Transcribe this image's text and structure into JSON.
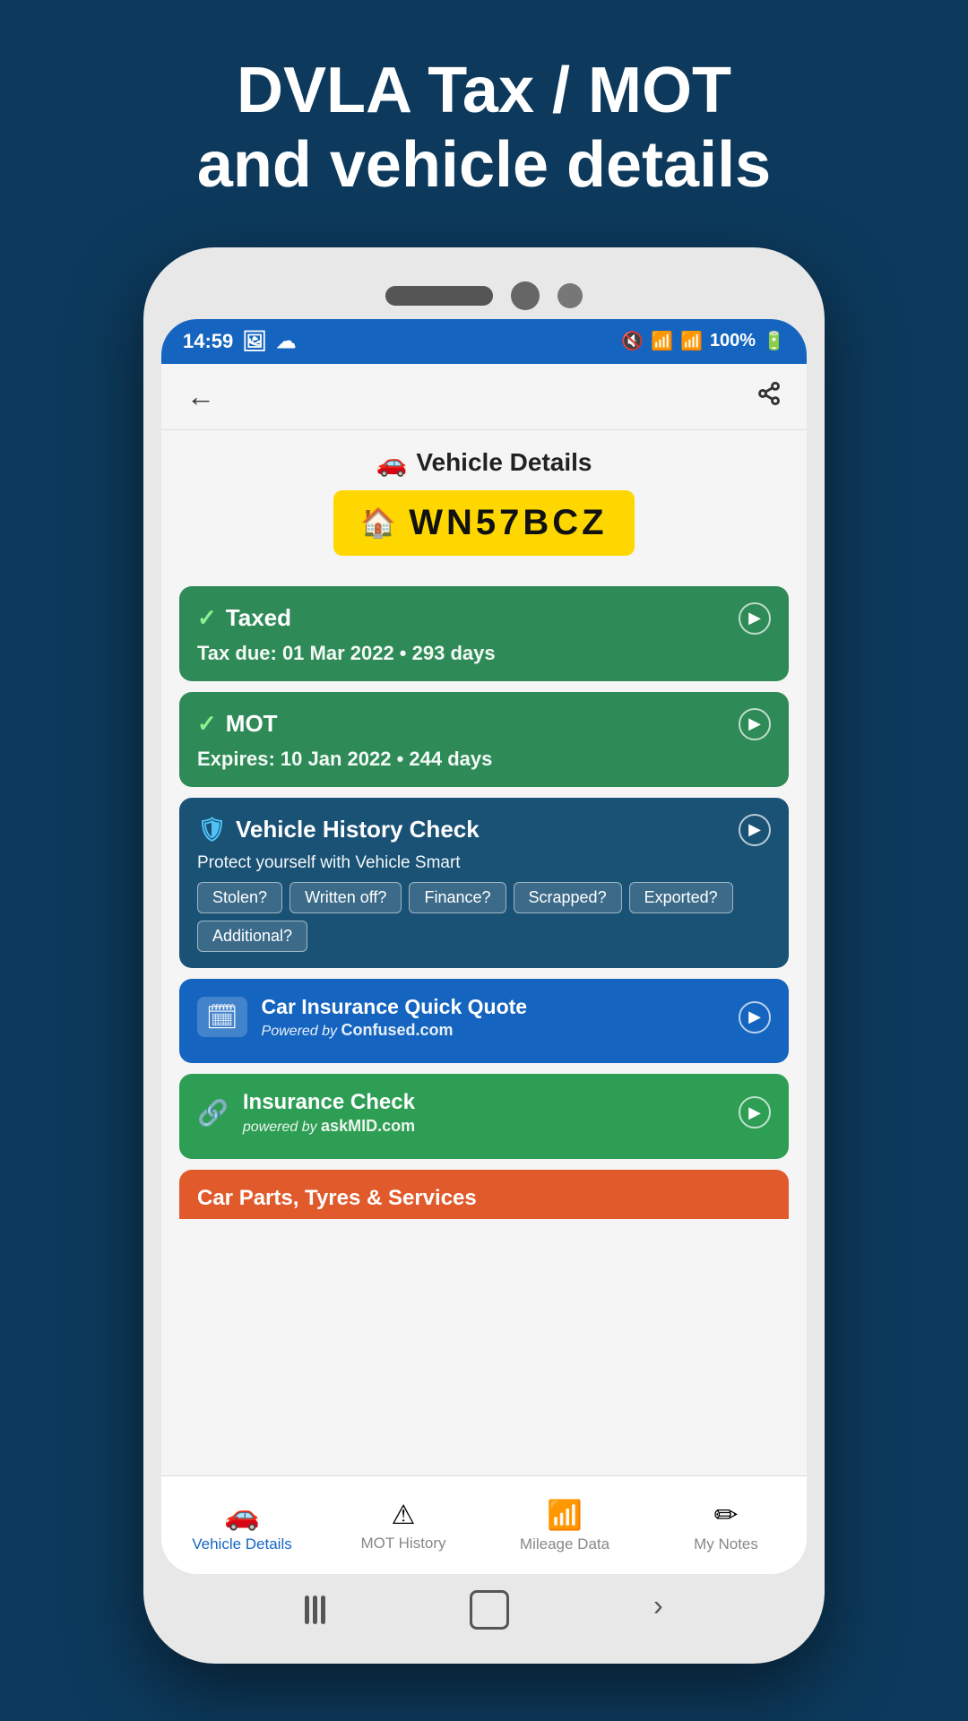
{
  "header": {
    "title_line1": "DVLA Tax / MOT",
    "title_line2": "and vehicle details"
  },
  "status_bar": {
    "time": "14:59",
    "battery": "100%"
  },
  "app_header": {
    "back_label": "←",
    "share_label": "⋮"
  },
  "vehicle_section": {
    "title": "Vehicle Details",
    "title_icon": "🚗",
    "plate_icon": "🏠",
    "plate_number": "WN57BCZ"
  },
  "taxed_card": {
    "title": "Taxed",
    "subtitle": "Tax due: 01 Mar 2022 • 293 days",
    "check": "✓"
  },
  "mot_card": {
    "title": "MOT",
    "subtitle": "Expires: 10 Jan 2022 • 244 days",
    "check": "✓"
  },
  "history_card": {
    "title": "Vehicle History Check",
    "subtitle": "Protect yourself with Vehicle Smart",
    "tags": [
      "Stolen?",
      "Written off?",
      "Finance?",
      "Scrapped?",
      "Exported?",
      "Additional?"
    ]
  },
  "insurance_quote_card": {
    "title": "Car Insurance Quick Quote",
    "powered_by": "Powered by",
    "brand": "Confused.com"
  },
  "insurance_check_card": {
    "title": "Insurance Check",
    "powered_by": "powered by",
    "brand": "askMID.com"
  },
  "partial_card": {
    "title": "Car Parts, Tyres & Services"
  },
  "bottom_nav": {
    "items": [
      {
        "label": "Vehicle Details",
        "icon": "🚗",
        "active": true
      },
      {
        "label": "MOT History",
        "icon": "⚠",
        "active": false
      },
      {
        "label": "Mileage Data",
        "icon": "📶",
        "active": false
      },
      {
        "label": "My Notes",
        "icon": "✏",
        "active": false
      }
    ]
  }
}
